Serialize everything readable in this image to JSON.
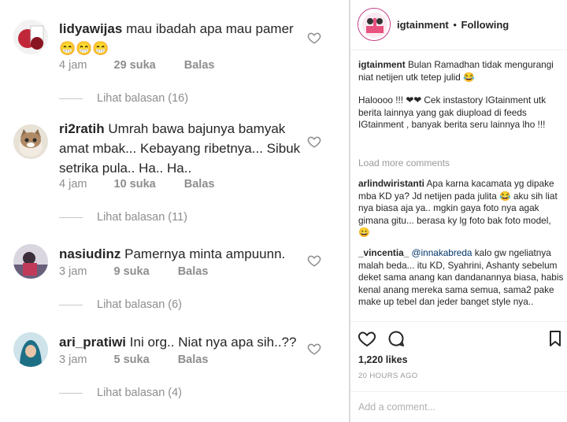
{
  "comments": [
    {
      "user": "lidyawijas",
      "text": "mau ibadah apa mau pamer",
      "emoji": "😁😁😁",
      "time": "4 jam",
      "likes": "29 suka",
      "reply": "Balas",
      "replies": "Lihat balasan (16)"
    },
    {
      "user": "ri2ratih",
      "text": "Umrah bawa bajunya bamyak amat mbak... Kebayang ribetnya... Sibuk setrika pula.. Ha.. Ha..",
      "time": "4 jam",
      "likes": "10 suka",
      "reply": "Balas",
      "replies": "Lihat balasan (11)"
    },
    {
      "user": "nasiudinz",
      "text": "Pamernya minta ampuunn.",
      "time": "3 jam",
      "likes": "9 suka",
      "reply": "Balas",
      "replies": "Lihat balasan (6)"
    },
    {
      "user": "ari_pratiwi",
      "text": "Ini org.. Niat nya apa sih..??",
      "time": "3 jam",
      "likes": "5 suka",
      "reply": "Balas",
      "replies": "Lihat balasan (4)"
    }
  ],
  "post": {
    "handle": "igtainment",
    "separator": "•",
    "follow_status": "Following",
    "caption_user": "igtainment",
    "caption_1": "Bulan Ramadhan tidak mengurangi niat netijen utk tetep julid",
    "caption_1_emoji": "😂",
    "caption_2": "Haloooo !!! ❤❤ Cek instastory IGtainment utk berita lainnya yang gak diupload di feeds IGtainment , banyak berita seru lainnya lho !!!",
    "load_more": "Load more comments",
    "comments": [
      {
        "user": "arlindwiristanti",
        "text": "Apa karna kacamata yg dipake mba KD ya? Jd netijen pada julita 😂 aku sih liat nya biasa aja ya.. mgkin gaya foto nya agak gimana gitu... berasa ky lg foto bak foto model, 😄"
      },
      {
        "user": "_vincentia_",
        "mention": "@innakabreda",
        "text": "kalo gw ngeliatnya malah beda... itu KD, Syahrini, Ashanty sebelum deket sama anang kan dandanannya biasa, habis kenal anang mereka sama semua, sama2 pake make up tebel dan jeder banget style nya.."
      }
    ],
    "likes": "1,220 likes",
    "timestamp": "20 HOURS AGO",
    "add_comment_placeholder": "Add a comment..."
  },
  "icons": {
    "comment_like": "heart-outline-icon",
    "post_like": "heart-icon",
    "post_comment": "comment-bubble-icon",
    "post_save": "bookmark-icon"
  },
  "colors": {
    "text": "#262626",
    "muted": "#8e8e8e",
    "mention": "#003569",
    "divider": "#dbdbdb"
  }
}
